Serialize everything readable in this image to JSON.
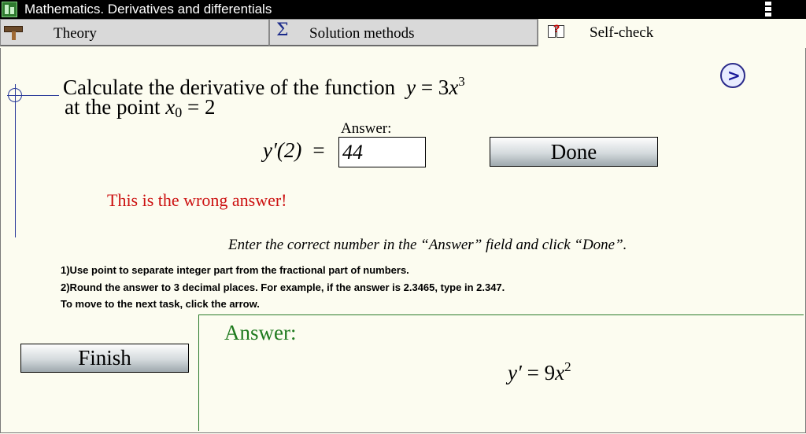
{
  "window": {
    "title": "Mathematics. Derivatives and differentials",
    "app_icon": "app-icon",
    "menu_icon": "more-vertical-icon"
  },
  "tabs": [
    {
      "label": "Theory",
      "icon": "hammer-icon",
      "active": false
    },
    {
      "label": "Solution methods",
      "icon": "sigma-icon",
      "icon_glyph": "Σ",
      "active": false
    },
    {
      "label": "Self-check",
      "icon": "book-icon",
      "active": true
    }
  ],
  "task": {
    "line1_text": "Calculate the derivative of the function",
    "line1_func_var": "y",
    "line1_func_eq": " = 3",
    "line1_func_x": "x",
    "line1_func_exp": "3",
    "line2_text": "at the point",
    "point_var": "x",
    "point_sub": "0",
    "point_value": " = 2"
  },
  "answer_form": {
    "caption": "Answer:",
    "derivative_label": "y′(2)",
    "equals": "=",
    "input_value": "44",
    "done_label": "Done"
  },
  "feedback": {
    "message": "This is the wrong answer!",
    "color": "#cc1111"
  },
  "instruction": "Enter the correct number in the “Answer” field and click “Done”.",
  "notes": [
    "1)Use point to separate integer part from the fractional part of numbers.",
    "2)Round the answer to 3 decimal places. For example, if the answer is 2.3465, type in 2.347.",
    "To move to the next task, click the arrow."
  ],
  "next_button": {
    "icon": "chevron-right-icon",
    "glyph": ">"
  },
  "finish_label": "Finish",
  "answer_panel": {
    "title": "Answer:",
    "formula_lhs": "y′",
    "formula_eq": " = 9",
    "formula_x": "x",
    "formula_exp": "2",
    "title_color": "#1f7a1f"
  }
}
